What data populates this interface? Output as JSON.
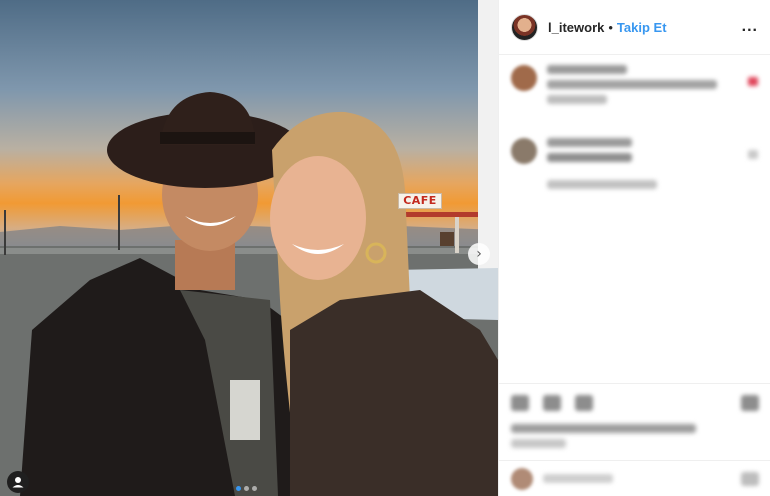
{
  "post": {
    "sign_text": "CAFE",
    "next_arrow": "›",
    "carousel": {
      "count": 3,
      "active_index": 0
    }
  },
  "header": {
    "username": "l_itework",
    "separator": "•",
    "follow_label": "Takip Et",
    "more_label": "..."
  },
  "colors": {
    "accent": "#3897f0",
    "text": "#262626",
    "border": "#efefef",
    "sign_red": "#c32a1e"
  },
  "icons": {
    "next": "chevron-right-icon",
    "tag": "user-tag-icon",
    "more": "more-options-icon",
    "like": "heart-icon",
    "comment": "comment-icon",
    "share": "share-icon",
    "save": "bookmark-icon",
    "emoji": "emoji-icon"
  }
}
